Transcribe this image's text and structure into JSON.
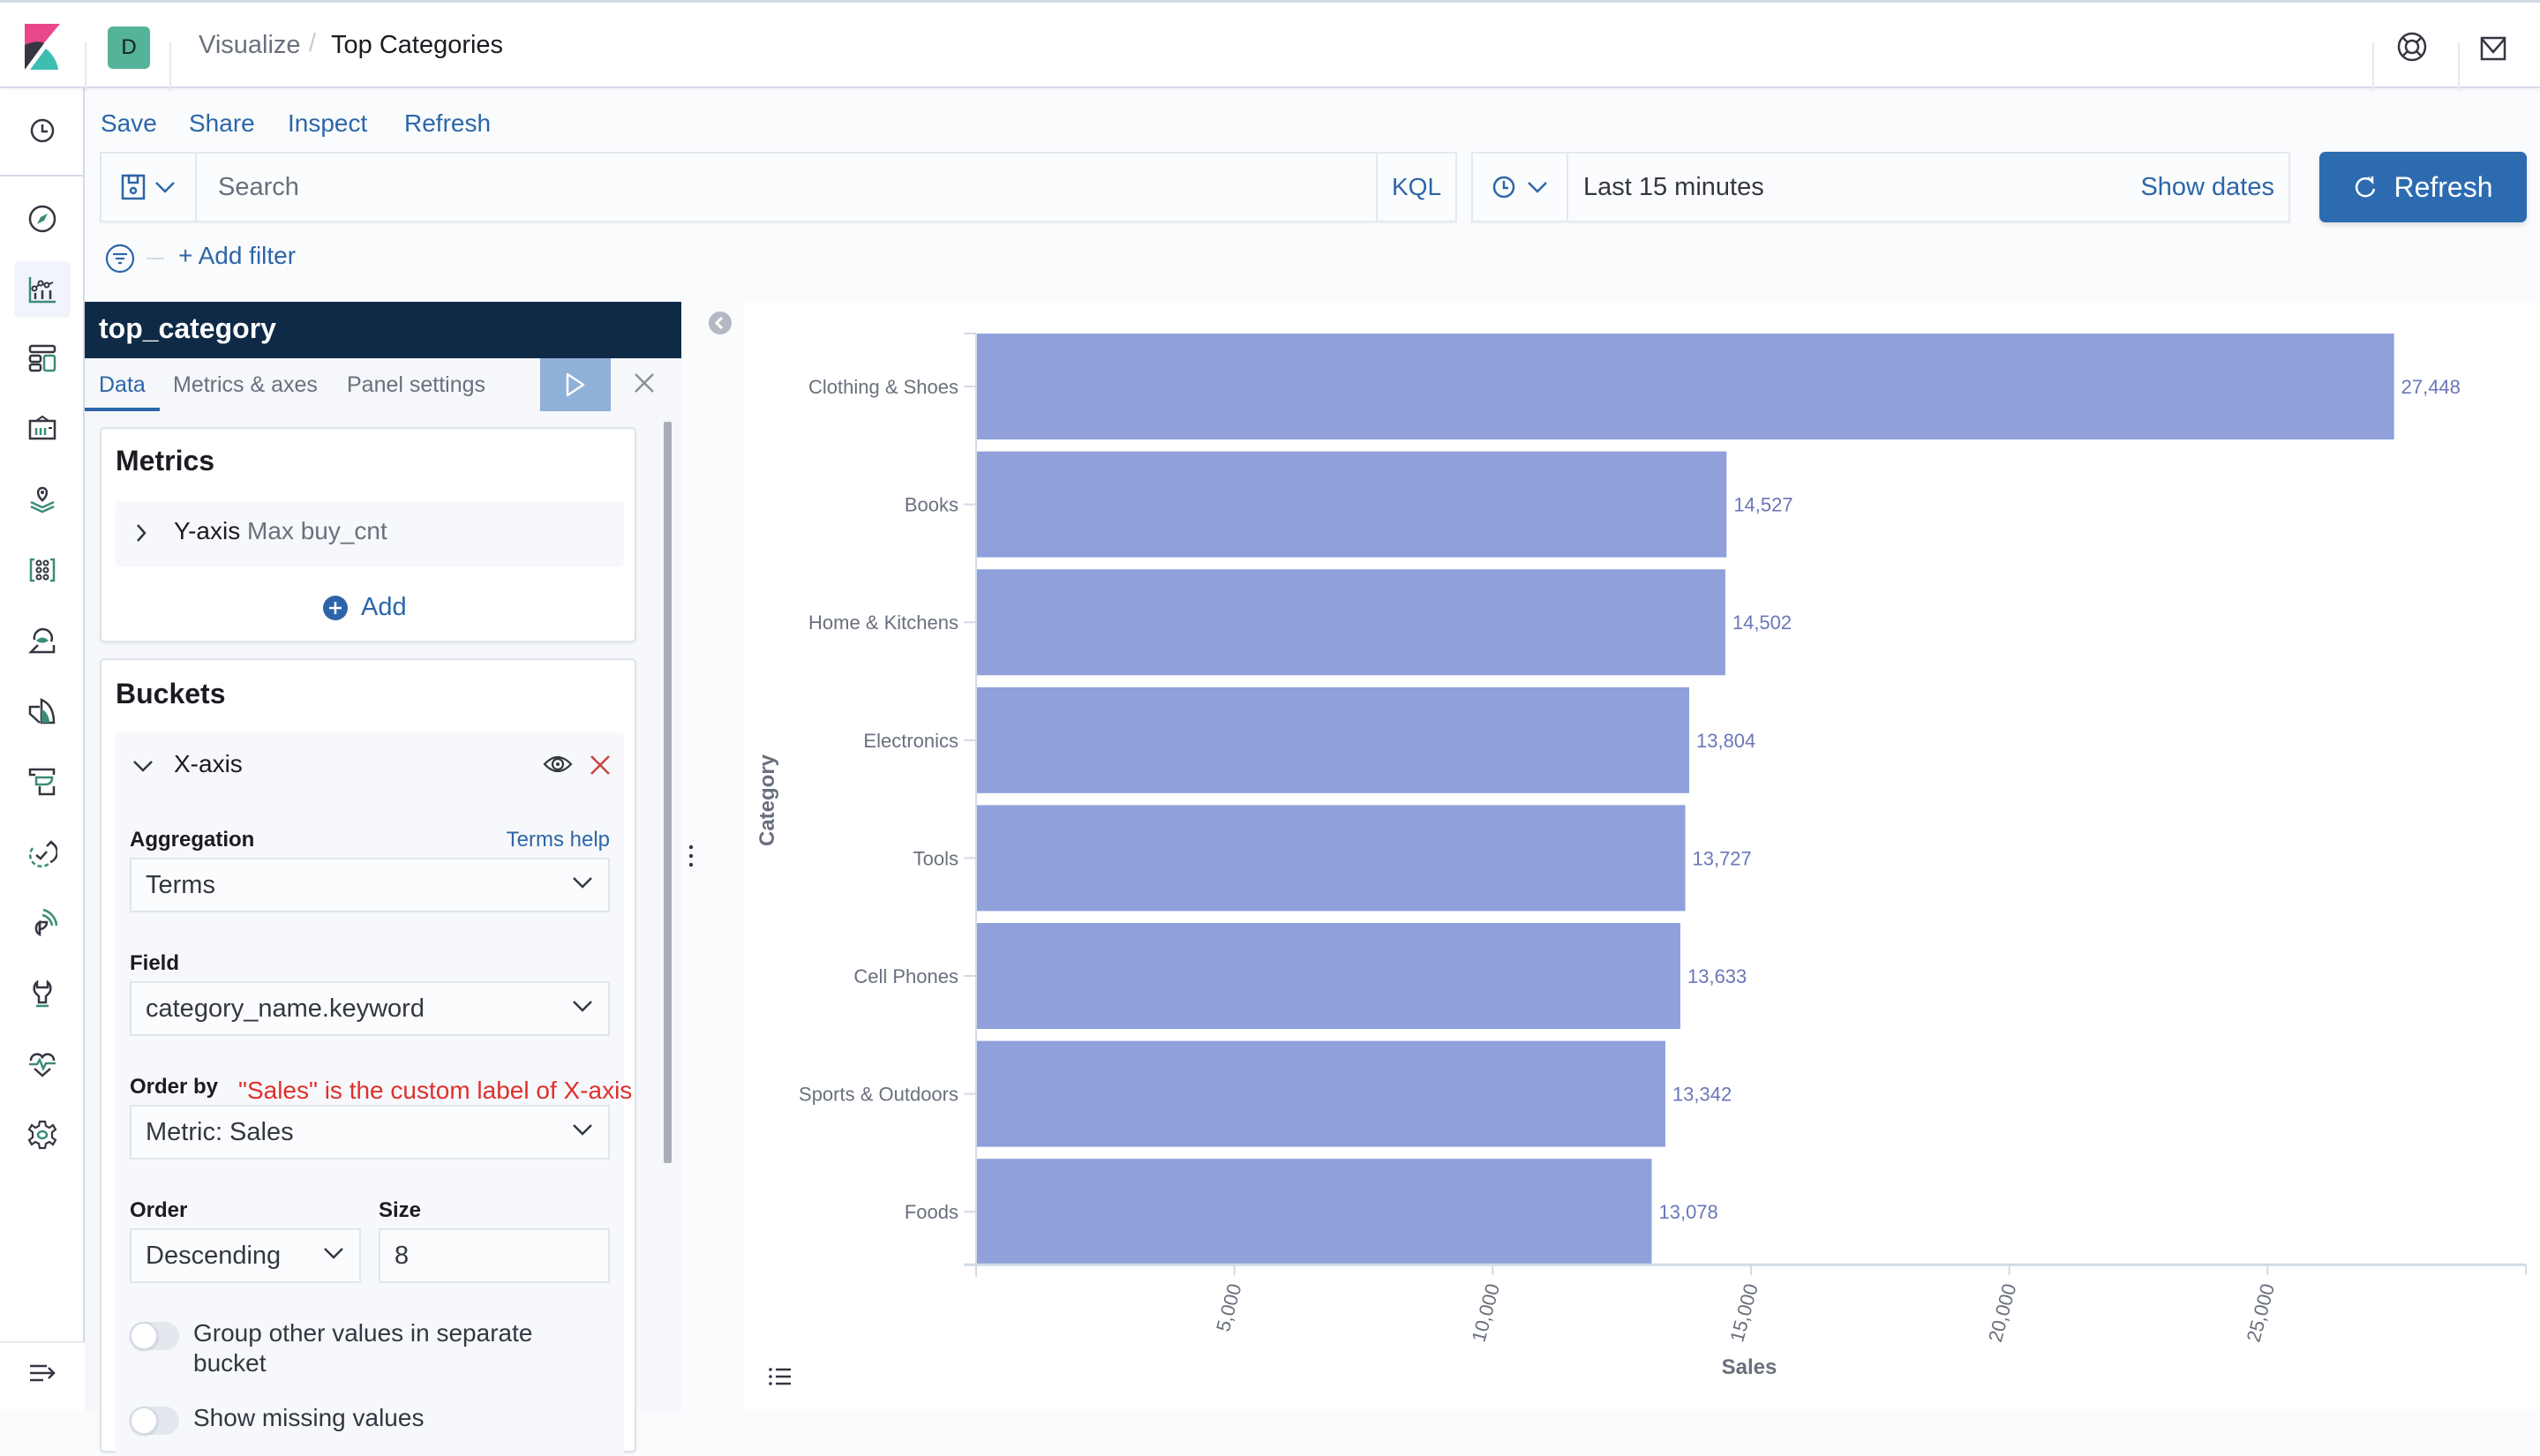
{
  "header": {
    "space_initial": "D",
    "breadcrumbs": [
      "Visualize",
      "Top Categories"
    ],
    "breadcrumb_separator": "/",
    "icons": [
      "kibana-logo",
      "help-icon",
      "mail-icon"
    ]
  },
  "leftnav": {
    "items": [
      {
        "name": "recently-viewed",
        "icon": "clock-icon"
      },
      {
        "name": "discover",
        "icon": "compass-icon"
      },
      {
        "name": "visualize",
        "icon": "visualize-icon",
        "active": true
      },
      {
        "name": "dashboard",
        "icon": "dashboard-icon"
      },
      {
        "name": "canvas",
        "icon": "canvas-icon"
      },
      {
        "name": "maps",
        "icon": "maps-icon"
      },
      {
        "name": "machine-learning",
        "icon": "ml-icon"
      },
      {
        "name": "siem",
        "icon": "siem-icon"
      },
      {
        "name": "apm",
        "icon": "apm-icon"
      },
      {
        "name": "infrastructure",
        "icon": "infrastructure-icon"
      },
      {
        "name": "uptime",
        "icon": "uptime-icon"
      },
      {
        "name": "monitoring",
        "icon": "monitoring-icon"
      },
      {
        "name": "dev-tools",
        "icon": "wrench-icon"
      },
      {
        "name": "stack-monitoring",
        "icon": "heartbeat-icon"
      },
      {
        "name": "management",
        "icon": "gear-icon"
      }
    ],
    "dock_icon": "dock-menu-icon"
  },
  "topnav": {
    "links": [
      "Save",
      "Share",
      "Inspect",
      "Refresh"
    ]
  },
  "query_bar": {
    "search_placeholder": "Search",
    "language": "KQL",
    "time_range": "Last 15 minutes",
    "show_dates": "Show dates",
    "refresh_label": "Refresh"
  },
  "filters": {
    "add_filter": "+ Add filter"
  },
  "editor": {
    "title": "top_category",
    "tabs": [
      "Data",
      "Metrics & axes",
      "Panel settings"
    ],
    "active_tab": "Data",
    "metrics": {
      "title": "Metrics",
      "item_axis": "Y-axis",
      "item_desc": "Max buy_cnt",
      "add_label": "Add"
    },
    "buckets": {
      "title": "Buckets",
      "item_axis": "X-axis",
      "aggregation_label": "Aggregation",
      "aggregation_help": "Terms help",
      "aggregation_value": "Terms",
      "field_label": "Field",
      "field_value": "category_name.keyword",
      "order_by_label": "Order by",
      "order_by_value": "Metric: Sales",
      "order_label": "Order",
      "order_value": "Descending",
      "size_label": "Size",
      "size_value": "8",
      "group_other_label": "Group other values in separate bucket",
      "group_other_enabled": false,
      "show_missing_label": "Show missing values",
      "show_missing_enabled": false
    },
    "annotation": "\"Sales\" is the custom label of X-axis"
  },
  "colors": {
    "bar": "#8fa0da",
    "accent": "#2d6bb0",
    "value_label": "#6a77b8",
    "annotation": "#e0302b"
  },
  "chart_data": {
    "type": "bar",
    "orientation": "horizontal",
    "title": "",
    "categories": [
      "Clothing & Shoes",
      "Books",
      "Home & Kitchens",
      "Electronics",
      "Tools",
      "Cell Phones",
      "Sports & Outdoors",
      "Foods"
    ],
    "values": [
      27448,
      14527,
      14502,
      13804,
      13727,
      13633,
      13342,
      13078
    ],
    "value_labels": [
      "27,448",
      "14,527",
      "14,502",
      "13,804",
      "13,727",
      "13,633",
      "13,342",
      "13,078"
    ],
    "xlabel": "Sales",
    "ylabel": "Category",
    "xlim": [
      0,
      30000
    ],
    "xticks": [
      0,
      5000,
      10000,
      15000,
      20000,
      25000,
      30000
    ],
    "xtick_labels": [
      "5,000",
      "10,000",
      "15,000",
      "20,000",
      "25,000"
    ],
    "grid": false,
    "legend": "none"
  }
}
